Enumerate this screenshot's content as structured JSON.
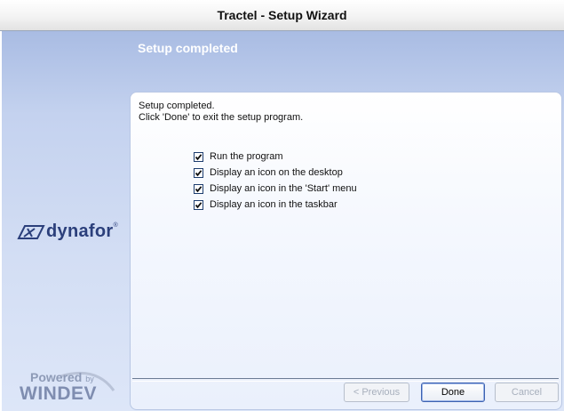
{
  "window": {
    "title": "Tractel - Setup Wizard"
  },
  "header": {
    "title": "Setup completed"
  },
  "content": {
    "line1": "Setup completed.",
    "line2": "Click 'Done' to exit the setup program.",
    "options": [
      {
        "label": "Run the program",
        "checked": true
      },
      {
        "label": "Display an icon on the desktop",
        "checked": true
      },
      {
        "label": "Display an icon in the 'Start' menu",
        "checked": true
      },
      {
        "label": "Display an icon in the taskbar",
        "checked": true
      }
    ]
  },
  "buttons": {
    "previous": "< Previous",
    "done": "Done",
    "cancel": "Cancel"
  },
  "branding": {
    "logo_text": "dynafor",
    "logo_mark": "®",
    "powered_by": "Powered",
    "powered_small": "by",
    "powered_brand": "WINDEV"
  },
  "colors": {
    "header_bg": "#a9bce3",
    "content_bg": "#eaf0fc",
    "logo": "#2b3f7b",
    "accent_border": "#3c61b0"
  }
}
